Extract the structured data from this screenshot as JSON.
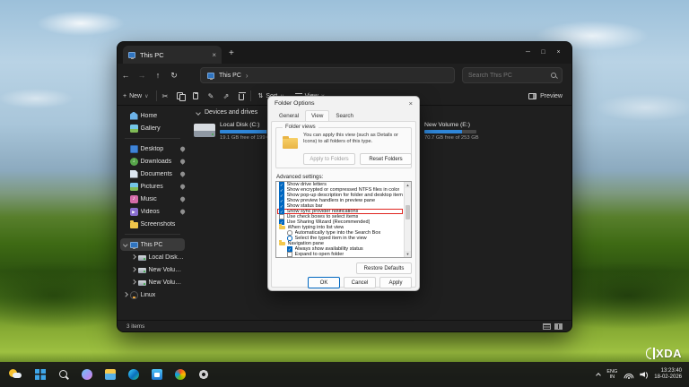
{
  "colors": {
    "accent": "#0067c0",
    "progress_blue": "#2f86d8",
    "highlight_red": "#e0241f"
  },
  "icons": {
    "back": "←",
    "forward": "→",
    "up": "↑",
    "refresh": "↻",
    "chevron_down": "∨",
    "chevron_right": "›",
    "plus": "+",
    "minimize": "─",
    "maximize": "□",
    "close": "×",
    "ellipsis": "…",
    "scroll_up": "▲",
    "scroll_down": "▼",
    "sort": "⇅",
    "tool_glyphs": {
      "cut": "✂",
      "rename": "✎",
      "share": "⇗"
    }
  },
  "explorer": {
    "tab_title": "This PC",
    "address": "This PC",
    "search_placeholder": "Search This PC",
    "commandbar": {
      "new": "New",
      "sort": "Sort",
      "view": "View",
      "preview": "Preview",
      "tools": [
        "cut",
        "copy",
        "paste",
        "rename",
        "share",
        "delete"
      ]
    },
    "sidebar": [
      {
        "label": "Home",
        "icon": "home"
      },
      {
        "label": "Gallery",
        "icon": "gallery"
      },
      {
        "type": "sep"
      },
      {
        "label": "Desktop",
        "icon": "desktop",
        "pinned": true
      },
      {
        "label": "Downloads",
        "icon": "downloads",
        "pinned": true
      },
      {
        "label": "Documents",
        "icon": "documents",
        "pinned": true
      },
      {
        "label": "Pictures",
        "icon": "pictures",
        "pinned": true
      },
      {
        "label": "Music",
        "icon": "music",
        "pinned": true
      },
      {
        "label": "Videos",
        "icon": "videos",
        "pinned": true
      },
      {
        "label": "Screenshots",
        "icon": "folder"
      },
      {
        "type": "sep"
      },
      {
        "label": "This PC",
        "icon": "pc",
        "selected": true,
        "chevron": "down"
      },
      {
        "label": "Local Disk (C:)",
        "icon": "drive",
        "indent": true,
        "chevron": "right"
      },
      {
        "label": "New Volume (D:)",
        "icon": "drive",
        "indent": true,
        "chevron": "right"
      },
      {
        "label": "New Volume (E:)",
        "icon": "drive",
        "indent": true,
        "chevron": "right"
      },
      {
        "label": "Linux",
        "icon": "linux",
        "chevron": "right"
      }
    ],
    "section_header": "Devices and drives",
    "drives": [
      {
        "name": "Local Disk (C:)",
        "caption": "19.1 GB free of 199 GB",
        "used_pct": 90,
        "show_icon": true
      },
      {
        "name": "New Volume (E:)",
        "caption": "70.7 GB free of 253 GB",
        "used_pct": 72,
        "show_icon": false
      }
    ],
    "status": "3 items"
  },
  "dialog": {
    "title": "Folder Options",
    "tabs": [
      "General",
      "View",
      "Search"
    ],
    "active_tab": "View",
    "folder_views": {
      "group_label": "Folder views",
      "description": "You can apply this view (such as Details or Icons) to all folders of this type.",
      "apply_button": "Apply to Folders",
      "reset_button": "Reset Folders"
    },
    "advanced_label": "Advanced settings:",
    "settings": [
      {
        "label": "Show drive letters",
        "type": "checkbox",
        "checked": true
      },
      {
        "label": "Show encrypted or compressed NTFS files in color",
        "type": "checkbox",
        "checked": true
      },
      {
        "label": "Show pop-up description for folder and desktop items",
        "type": "checkbox",
        "checked": true
      },
      {
        "label": "Show preview handlers in preview pane",
        "type": "checkbox",
        "checked": true
      },
      {
        "label": "Show status bar",
        "type": "checkbox",
        "checked": true
      },
      {
        "label": "Show sync provider notifications",
        "type": "checkbox",
        "checked": true,
        "highlighted": true
      },
      {
        "label": "Use check boxes to select items",
        "type": "checkbox",
        "checked": false
      },
      {
        "label": "Use Sharing Wizard (Recommended)",
        "type": "checkbox",
        "checked": true
      },
      {
        "label": "When typing into list view",
        "type": "group"
      },
      {
        "label": "Automatically type into the Search Box",
        "type": "radio",
        "checked": false,
        "indent": true
      },
      {
        "label": "Select the typed item in the view",
        "type": "radio",
        "checked": true,
        "indent": true
      },
      {
        "label": "Navigation pane",
        "type": "group"
      },
      {
        "label": "Always show availability status",
        "type": "checkbox",
        "checked": true,
        "indent": true
      },
      {
        "label": "Expand to open folder",
        "type": "checkbox",
        "checked": false,
        "indent": true
      }
    ],
    "buttons": {
      "restore": "Restore Defaults",
      "ok": "OK",
      "cancel": "Cancel",
      "apply": "Apply"
    }
  },
  "taskbar": {
    "icons": [
      "start",
      "search",
      "copilot",
      "file-explorer",
      "edge",
      "store",
      "photos",
      "settings"
    ],
    "tray": {
      "lang_primary": "ENG",
      "lang_secondary": "IN",
      "time": "13:23:40",
      "date": "18-02-2026"
    }
  },
  "watermark": "XDA"
}
